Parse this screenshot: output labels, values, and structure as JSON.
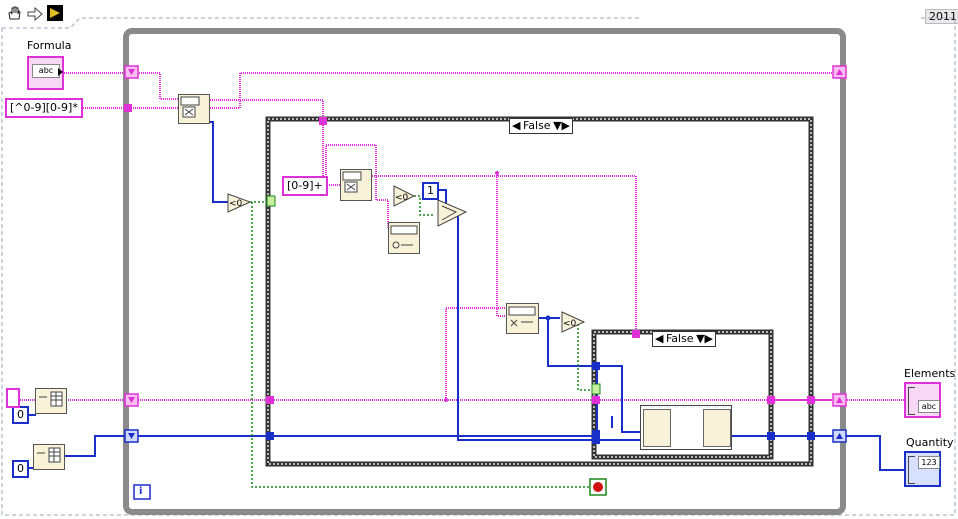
{
  "toolbar": {
    "version": "2011"
  },
  "controls": {
    "formula": {
      "label": "Formula",
      "type": "abc"
    },
    "pattern1": "[^0-9][0-9]*",
    "pattern2": "[0-9]+",
    "zero1": "0",
    "zero2": "0",
    "one": "1"
  },
  "indicators": {
    "elements": {
      "label": "Elements",
      "type": "abc"
    },
    "quantity": {
      "label": "Quantity",
      "type": "123"
    }
  },
  "case_structures": [
    {
      "selector": "False"
    },
    {
      "selector": "False"
    }
  ],
  "loop": {
    "iteration": "i"
  },
  "colors": {
    "string_wire": "#e030d8",
    "numeric_wire": "#1a2fc8",
    "boolean_wire": "#1a8a1a",
    "loop_frame": "#7a7a7a"
  }
}
